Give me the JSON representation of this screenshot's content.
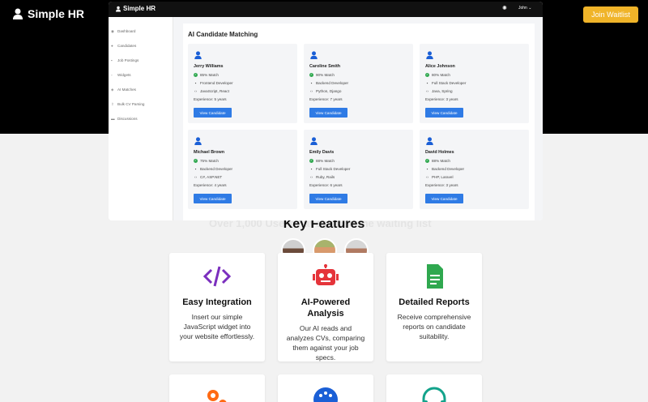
{
  "landing": {
    "brand": "Simple HR",
    "cta": "Join Waitlist",
    "faint_text": "Over 1,000 Users have joined the waiting list",
    "key_features_title": "Key Features",
    "features": [
      {
        "icon": "code-icon",
        "title": "Easy Integration",
        "desc": "Insert our simple JavaScript widget into your website effortlessly.",
        "color": "#7b2fbe"
      },
      {
        "icon": "robot-icon",
        "title": "AI-Powered Analysis",
        "desc": "Our AI reads and analyzes CVs, comparing them against your job specs.",
        "color": "#e5343a"
      },
      {
        "icon": "document-icon",
        "title": "Detailed Reports",
        "desc": "Receive comprehensive reports on candidate suitability.",
        "color": "#2fa84f"
      },
      {
        "icon": "gears-icon",
        "color": "#ff6a13"
      },
      {
        "icon": "palette-icon",
        "color": "#1a5fd6"
      },
      {
        "icon": "headset-icon",
        "color": "#13a38b"
      }
    ]
  },
  "app": {
    "title": "Simple HR",
    "user": "John",
    "sidebar": [
      {
        "label": "Dashboard",
        "icon": "dashboard-icon"
      },
      {
        "label": "Candidates",
        "icon": "user-icon"
      },
      {
        "label": "Job Postings",
        "icon": "briefcase-icon"
      },
      {
        "label": "Widgets",
        "icon": "widget-icon"
      },
      {
        "label": "AI Matches",
        "icon": "ai-icon"
      },
      {
        "label": "Bulk CV Parsing",
        "icon": "upload-icon"
      },
      {
        "label": "Discussions",
        "icon": "chat-icon"
      }
    ],
    "panel_title": "AI Candidate Matching",
    "view_label": "View Candidate",
    "candidates": [
      {
        "name": "Jerry Williams",
        "match": "85% Match",
        "role": "Frontend Developer",
        "skills": "JavaScript, React",
        "experience": "Experience: 5 years"
      },
      {
        "name": "Caroline Smith",
        "match": "90% Match",
        "role": "Backend Developer",
        "skills": "Python, Django",
        "experience": "Experience: 7 years"
      },
      {
        "name": "Alice Johnson",
        "match": "80% Match",
        "role": "Full Stack Developer",
        "skills": "Java, Spring",
        "experience": "Experience: 3 years"
      },
      {
        "name": "Michael Brown",
        "match": "75% Match",
        "role": "Backend Developer",
        "skills": "C#, ASP.NET",
        "experience": "Experience: 4 years"
      },
      {
        "name": "Emily Davis",
        "match": "88% Match",
        "role": "Full Stack Developer",
        "skills": "Ruby, Rails",
        "experience": "Experience: 6 years"
      },
      {
        "name": "David Holmes",
        "match": "88% Match",
        "role": "Backend Developer",
        "skills": "PHP, Laravel",
        "experience": "Experience: 3 years"
      }
    ]
  }
}
